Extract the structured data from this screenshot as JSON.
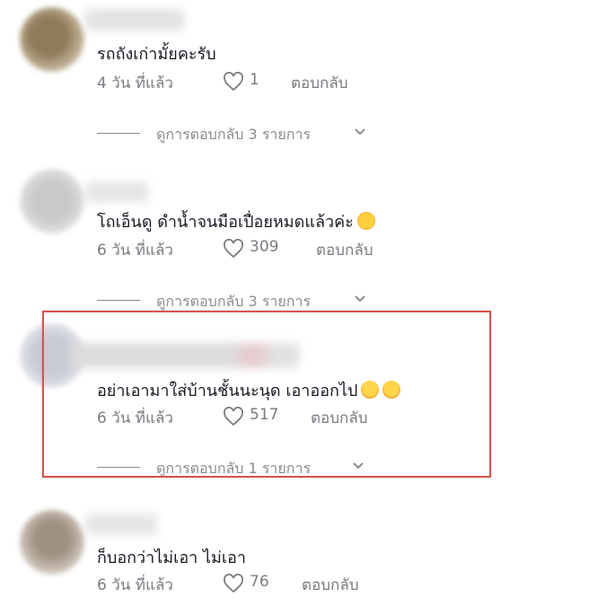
{
  "comments": [
    {
      "text": "รถถังเก่ามั้ยคะรับ",
      "time": "4 วัน ที่แล้ว",
      "likes": "1",
      "reply_label": "ตอบกลับ",
      "view_replies": "ดูการตอบกลับ 3 รายการ"
    },
    {
      "text": "โถเอ็นดู ดำน้ำจนมือเปื่อยหมดแล้วค่ะ",
      "emoji": "smiling-sweat-emoji",
      "time": "6 วัน ที่แล้ว",
      "likes": "309",
      "reply_label": "ตอบกลับ",
      "view_replies": "ดูการตอบกลับ 3 รายการ"
    },
    {
      "text": "อย่าเอามาใส่บ้านชั้นนะนุด เอาออกไป",
      "emoji": "rolling-laughing-emoji",
      "time": "6 วัน ที่แล้ว",
      "likes": "517",
      "reply_label": "ตอบกลับ",
      "view_replies": "ดูการตอบกลับ 1 รายการ"
    },
    {
      "text": "ก็บอกว่าไม่เอา ไม่เอา",
      "time": "6 วัน ที่แล้ว",
      "likes": "76",
      "reply_label": "ตอบกลับ"
    }
  ],
  "colors": {
    "text": "#161823",
    "meta": "#7a7b82",
    "highlight": "#d9534f"
  }
}
